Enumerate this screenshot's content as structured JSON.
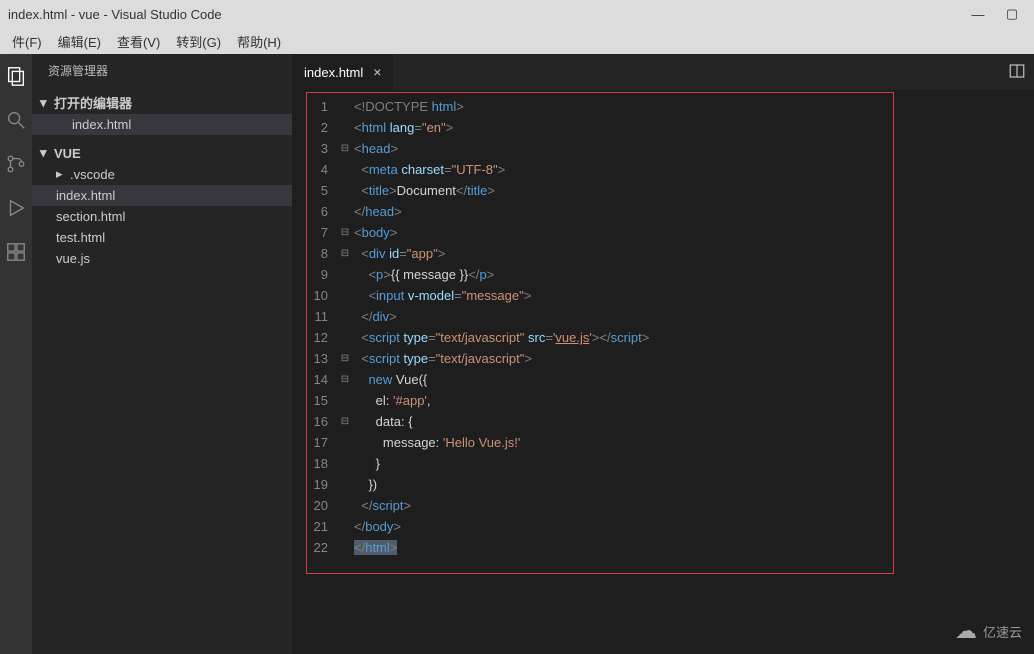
{
  "window": {
    "title": "index.html - vue - Visual Studio Code",
    "controls": {
      "minimize": "—",
      "maximize": "▢"
    }
  },
  "menubar": {
    "file": "件(F)",
    "edit": "编辑(E)",
    "view": "查看(V)",
    "goto": "转到(G)",
    "help": "帮助(H)"
  },
  "sidebar": {
    "header": "资源管理器",
    "open_editors": "打开的编辑器",
    "open_file": "index.html",
    "project": "VUE",
    "items": {
      "vscode": ".vscode",
      "indexhtml": "index.html",
      "sectionhtml": "section.html",
      "testhtml": "test.html",
      "vuejs": "vue.js"
    }
  },
  "tab": {
    "name": "index.html",
    "close": "×"
  },
  "code": {
    "lines": [
      "1",
      "2",
      "3",
      "4",
      "5",
      "6",
      "7",
      "8",
      "9",
      "10",
      "11",
      "12",
      "13",
      "14",
      "15",
      "16",
      "17",
      "18",
      "19",
      "20",
      "21",
      "22"
    ],
    "fold": {
      "3": "⊟",
      "7": "⊟",
      "8": "⊟",
      "13": "⊟",
      "14": "⊟",
      "16": "⊟"
    },
    "l1": {
      "a": "<!DOCTYPE ",
      "b": "html",
      "c": ">"
    },
    "l2": {
      "a": "<",
      "b": "html",
      "c": " lang",
      "d": "=",
      "e": "\"en\"",
      "f": ">"
    },
    "l3": {
      "a": "<",
      "b": "head",
      "c": ">"
    },
    "l4": {
      "a": "<",
      "b": "meta",
      "c": " charset",
      "d": "=",
      "e": "\"UTF-8\"",
      "f": ">"
    },
    "l5": {
      "a": "<",
      "b": "title",
      "c": ">",
      "d": "Document",
      "e": "</",
      "f": "title",
      "g": ">"
    },
    "l6": {
      "a": "</",
      "b": "head",
      "c": ">"
    },
    "l7": {
      "a": "<",
      "b": "body",
      "c": ">"
    },
    "l8": {
      "a": "<",
      "b": "div",
      "c": " id",
      "d": "=",
      "e": "\"app\"",
      "f": ">"
    },
    "l9": {
      "a": "<",
      "b": "p",
      "c": ">",
      "d": "{{ message }}",
      "e": "</",
      "f": "p",
      "g": ">"
    },
    "l10": {
      "a": "<",
      "b": "input",
      "c": " v-model",
      "d": "=",
      "e": "\"message\"",
      "f": ">"
    },
    "l11": {
      "a": "</",
      "b": "div",
      "c": ">"
    },
    "l12": {
      "a": "<",
      "b": "script",
      "c": " type",
      "d": "=",
      "e": "\"text/javascript\"",
      "f": " src",
      "g": "=",
      "h": "'",
      "i": "vue.js",
      "j": "'",
      "k": "></",
      "l": "script",
      "m": ">"
    },
    "l13": {
      "a": "<",
      "b": "script",
      "c": " type",
      "d": "=",
      "e": "\"text/javascript\"",
      "f": ">"
    },
    "l14": {
      "a": "new",
      "b": " Vue({"
    },
    "l15": {
      "a": "el: ",
      "b": "'#app'",
      "c": ","
    },
    "l16": {
      "a": "data: {"
    },
    "l17": {
      "a": "message: ",
      "b": "'Hello Vue.js!'"
    },
    "l18": {
      "a": "}"
    },
    "l19": {
      "a": "})"
    },
    "l20": {
      "a": "</",
      "b": "script",
      "c": ">"
    },
    "l21": {
      "a": "</",
      "b": "body",
      "c": ">"
    },
    "l22": {
      "a": "</",
      "b": "html",
      "c": ">"
    }
  },
  "watermark": "亿速云"
}
